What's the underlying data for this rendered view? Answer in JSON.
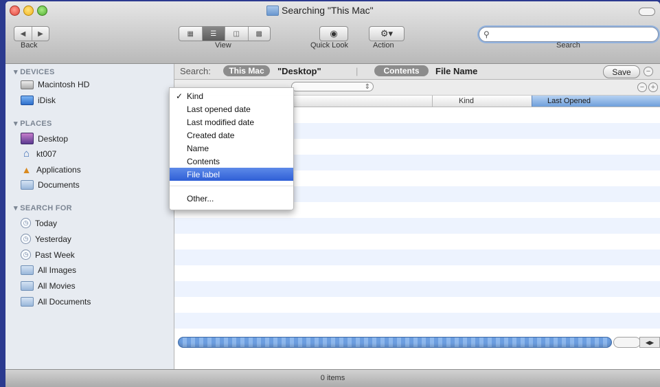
{
  "window": {
    "title": "Searching \"This Mac\""
  },
  "toolbar": {
    "back_label": "Back",
    "view_label": "View",
    "quick_look_label": "Quick Look",
    "action_label": "Action",
    "search_label": "Search",
    "search_value": "",
    "view_modes": [
      "icon-view-icon",
      "list-view-icon",
      "column-view-icon",
      "coverflow-view-icon"
    ],
    "selected_view_mode": "list-view-icon"
  },
  "sidebar": {
    "devices_header": "DEVICES",
    "places_header": "PLACES",
    "search_for_header": "SEARCH FOR",
    "devices": [
      {
        "label": "Macintosh HD",
        "icon": "hard-disk-icon"
      },
      {
        "label": "iDisk",
        "icon": "idisk-icon"
      }
    ],
    "places": [
      {
        "label": "Desktop",
        "icon": "desktop-icon"
      },
      {
        "label": "kt007",
        "icon": "home-icon"
      },
      {
        "label": "Applications",
        "icon": "applications-icon"
      },
      {
        "label": "Documents",
        "icon": "documents-folder-icon"
      }
    ],
    "search_for": [
      {
        "label": "Today",
        "icon": "clock-icon"
      },
      {
        "label": "Yesterday",
        "icon": "clock-icon"
      },
      {
        "label": "Past Week",
        "icon": "clock-icon"
      },
      {
        "label": "All Images",
        "icon": "smart-folder-icon"
      },
      {
        "label": "All Movies",
        "icon": "smart-folder-icon"
      },
      {
        "label": "All Documents",
        "icon": "smart-folder-icon"
      }
    ]
  },
  "searchbar": {
    "search_label": "Search:",
    "scope_this_mac": "This Mac",
    "scope_desktop": "\"Desktop\"",
    "contents": "Contents",
    "file_name": "File Name",
    "save": "Save"
  },
  "columns": {
    "kind": "Kind",
    "last_opened": "Last Opened"
  },
  "criteria_menu": {
    "items": [
      "Kind",
      "Last opened date",
      "Last modified date",
      "Created date",
      "Name",
      "Contents",
      "File label"
    ],
    "checked": "Kind",
    "highlighted": "File label",
    "other": "Other..."
  },
  "status": {
    "items_count": "0 items"
  },
  "colors": {
    "desktop_background": "#2b3a8f",
    "selection": "#3a6be0",
    "sidebar_bg": "#e7ebf1",
    "stripe": "#edf3fe"
  }
}
